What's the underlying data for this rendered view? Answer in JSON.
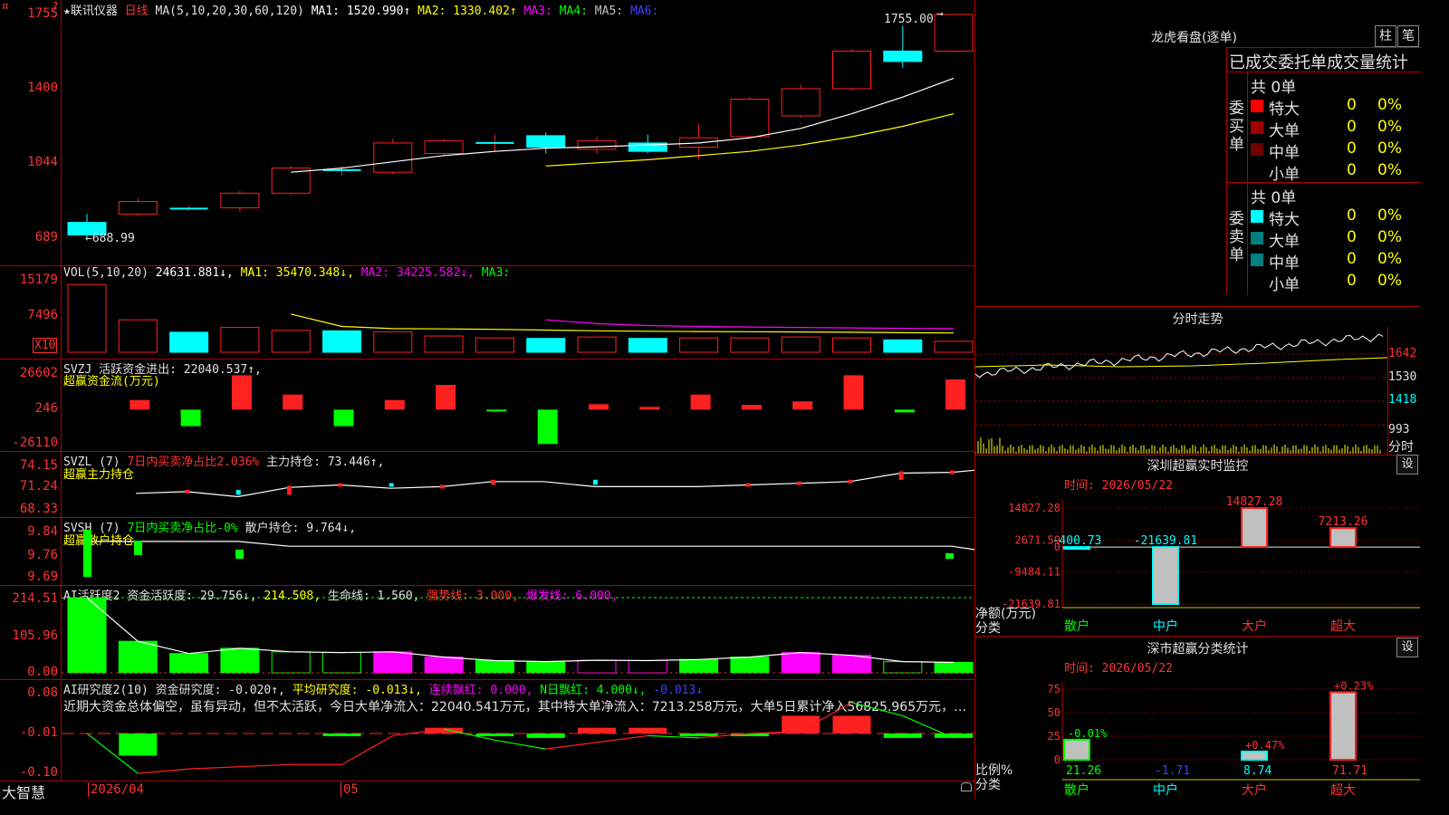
{
  "colors": {
    "up": "#ff2020",
    "down": "#00ffff",
    "green": "#00ff00",
    "magenta": "#ff00ff",
    "yellow": "#ffff00",
    "grid": "#b00000",
    "white": "#ffffff"
  },
  "corner": {
    "left_icon": "¤",
    "right_icon": "?"
  },
  "main": {
    "title_star": "★联讯仪器",
    "period": "日线",
    "ma_label": "MA(5,10,20,30,60,120)",
    "ma1": "MA1: 1520.990↑",
    "ma2": "MA2: 1330.402↑",
    "ma3": "MA3:",
    "ma4": "MA4:",
    "ma5": "MA5:",
    "ma6": "MA6:",
    "yticks": [
      "1755",
      "1400",
      "1044",
      "689"
    ],
    "high_label": "1755.00",
    "low_label": "←688.99"
  },
  "vol": {
    "label": "VOL(5,10,20)",
    "value": "24631.881↓,",
    "ma1": "MA1: 35470.348↓,",
    "ma2": "MA2: 34225.582↓,",
    "ma3": "MA3:",
    "yticks": [
      "15179",
      "7496"
    ],
    "unit": "X10"
  },
  "svzj": {
    "line1_a": "SVZJ  活跃资金进出: 22040.537↑,",
    "line2": "超赢资金流(万元)",
    "yticks": [
      "26602",
      "246",
      "-26110"
    ]
  },
  "svzl": {
    "line1_a": "SVZL (7) ",
    "line1_b": "7日内买卖净占比2.036%",
    "line1_c": " 主力持仓: 73.446↑,",
    "line2": "超赢主力持仓",
    "yticks": [
      "74.15",
      "71.24",
      "68.33"
    ]
  },
  "svsh": {
    "line1_a": "SVSH (7) ",
    "line1_b": "7日内买卖净占比-0%",
    "line1_c": " 散户持仓: 9.764↓,",
    "line2": "超赢散户持仓",
    "yticks": [
      "9.84",
      "9.76",
      "9.69"
    ]
  },
  "ai_act": {
    "a": "AI活跃度2 资金活跃度: 29.756↓,",
    "b": " 214.508,",
    "c": " 生命线: 1.560,",
    "d": " 强势线: 3.000,",
    "e": " 爆发线: 6.000,",
    "yticks": [
      "214.51",
      "105.96",
      "0.00"
    ]
  },
  "ai_res": {
    "a": "AI研究度2(10) 资金研究度: -0.020↑,",
    "b": " 平均研究度: -0.013↓,",
    "c": " 连续飘红: 0.000,",
    "d": " N日飘红: 4.000↓,",
    "e": " -0.013↓",
    "comment": "近期大资金总体偏空，虽有异动，但不太活跃，今日大单净流入：22040.541万元，其中特大单净流入：7213.258万元，大单5日累计净入56825.965万元，…",
    "yticks": [
      "0.08",
      "-0.01",
      "-0.10"
    ]
  },
  "chart_data": [
    {
      "type": "candlestick",
      "title": "★联讯仪器 日线",
      "ylim": [
        689,
        1755
      ],
      "candles": [
        {
          "o": 760,
          "c": 700,
          "h": 800,
          "l": 688.99,
          "up": false
        },
        {
          "o": 800,
          "c": 860,
          "h": 875,
          "l": 790,
          "up": true
        },
        {
          "o": 826,
          "c": 826,
          "h": 840,
          "l": 815,
          "up": "doji"
        },
        {
          "o": 830,
          "c": 900,
          "h": 910,
          "l": 810,
          "up": true
        },
        {
          "o": 900,
          "c": 1020,
          "h": 1030,
          "l": 890,
          "up": true
        },
        {
          "o": 1010,
          "c": 1010,
          "h": 1030,
          "l": 985,
          "up": "doji"
        },
        {
          "o": 1000,
          "c": 1140,
          "h": 1160,
          "l": 990,
          "up": true
        },
        {
          "o": 1090,
          "c": 1150,
          "h": 1160,
          "l": 1080,
          "up": true
        },
        {
          "o": 1140,
          "c": 1140,
          "h": 1180,
          "l": 1100,
          "up": "doji"
        },
        {
          "o": 1175,
          "c": 1120,
          "h": 1190,
          "l": 1090,
          "up": false
        },
        {
          "o": 1110,
          "c": 1150,
          "h": 1170,
          "l": 1090,
          "up": true
        },
        {
          "o": 1140,
          "c": 1100,
          "h": 1180,
          "l": 1090,
          "up": false
        },
        {
          "o": 1120,
          "c": 1165,
          "h": 1230,
          "l": 1060,
          "up": true
        },
        {
          "o": 1170,
          "c": 1350,
          "h": 1360,
          "l": 1160,
          "up": true
        },
        {
          "o": 1270,
          "c": 1400,
          "h": 1420,
          "l": 1260,
          "up": true
        },
        {
          "o": 1400,
          "c": 1580,
          "h": 1590,
          "l": 1390,
          "up": true
        },
        {
          "o": 1580,
          "c": 1530,
          "h": 1700,
          "l": 1500,
          "up": false
        },
        {
          "o": 1580,
          "c": 1755,
          "h": 1755,
          "l": 1575,
          "up": true
        }
      ],
      "ma1": [
        null,
        null,
        null,
        null,
        1000,
        1020,
        1050,
        1080,
        1100,
        1115,
        1122,
        1130,
        1140,
        1165,
        1210,
        1280,
        1360,
        1450
      ],
      "ma2": [
        null,
        null,
        null,
        null,
        null,
        null,
        null,
        null,
        null,
        1030,
        1045,
        1060,
        1080,
        1100,
        1130,
        1170,
        1220,
        1280
      ]
    },
    {
      "type": "bar",
      "title": "VOL(5,10,20)",
      "ylim": [
        0,
        15179
      ],
      "values": [
        14200,
        6800,
        4200,
        5200,
        4600,
        4500,
        4300,
        3400,
        3000,
        2900,
        3200,
        2900,
        3000,
        3000,
        3200,
        3000,
        2600,
        2300
      ],
      "up": [
        true,
        true,
        false,
        true,
        true,
        false,
        true,
        true,
        true,
        false,
        true,
        false,
        true,
        true,
        true,
        true,
        false,
        true
      ],
      "ma1": [
        null,
        null,
        null,
        null,
        8000,
        5400,
        4950,
        4900,
        4800,
        4650,
        4500,
        4400,
        4350,
        4300,
        4250,
        4200,
        4100,
        4050
      ],
      "ma2": [
        null,
        null,
        null,
        null,
        null,
        null,
        null,
        null,
        null,
        6800,
        6000,
        5600,
        5400,
        5300,
        5200,
        5100,
        5000,
        4950
      ]
    },
    {
      "type": "bar",
      "title": "SVZJ 活跃资金进出",
      "ylim": [
        -26110,
        26602
      ],
      "values": [
        0,
        7000,
        -12000,
        25000,
        11000,
        -12000,
        7000,
        18000,
        -500,
        -25000,
        4000,
        2000,
        11000,
        3500,
        6000,
        25000,
        -2000,
        22000
      ]
    },
    {
      "type": "line",
      "title": "SVZL 主力持仓",
      "ylim": [
        68.33,
        74.15
      ],
      "values": [
        null,
        70.4,
        70.6,
        70.0,
        71.1,
        71.4,
        71.0,
        71.2,
        71.8,
        71.8,
        71.2,
        71.2,
        71.2,
        71.4,
        71.6,
        71.8,
        72.8,
        72.9,
        73.446
      ]
    },
    {
      "type": "line",
      "title": "SVSH 散户持仓",
      "ylim": [
        9.69,
        9.84
      ],
      "values": [
        9.8,
        9.8,
        9.8,
        9.8,
        9.786,
        9.786,
        9.786,
        9.786,
        9.786,
        9.786,
        9.786,
        9.786,
        9.786,
        9.786,
        9.786,
        9.786,
        9.786,
        9.786,
        9.764
      ]
    },
    {
      "type": "bar",
      "title": "AI活跃度2",
      "ylim": [
        0,
        214.51
      ],
      "values": [
        214.51,
        90,
        55,
        70,
        60,
        58,
        60,
        45,
        35,
        32,
        36,
        35,
        38,
        45,
        58,
        50,
        32,
        29.756
      ],
      "colors": [
        "green",
        "green",
        "green",
        "green",
        "green",
        "green",
        "magenta",
        "magenta",
        "green",
        "green",
        "magenta",
        "magenta",
        "green",
        "green",
        "magenta",
        "magenta",
        "green",
        "green"
      ]
    },
    {
      "type": "bar",
      "title": "AI研究度2(10)",
      "ylim": [
        -0.1,
        0.08
      ],
      "values": [
        0,
        -0.06,
        0,
        0,
        0,
        -0.002,
        0,
        0.003,
        -0.01,
        -0.02,
        0.003,
        0.003,
        -0.003,
        -0.01,
        0.03,
        0.03,
        -0.02,
        -0.02
      ],
      "line": [
        -0.01,
        -0.1,
        -0.09,
        -0.085,
        -0.08,
        -0.08,
        -0.015,
        0.0,
        -0.025,
        -0.045,
        -0.03,
        -0.015,
        -0.02,
        -0.01,
        -0.005,
        0.06,
        0.03,
        -0.02
      ]
    },
    {
      "type": "line",
      "title": "分时走势",
      "yticks": [
        "1642",
        "1530",
        "1418",
        "993"
      ]
    },
    {
      "type": "bar",
      "title": "深圳超赢实时监控",
      "categories": [
        "散户",
        "中户",
        "大户",
        "超大"
      ],
      "values": [
        -400.73,
        -21639.81,
        14827.28,
        7213.26
      ],
      "ylim": [
        -21639.81,
        14827.28
      ],
      "yticks": [
        "14827.28",
        "2671.59",
        "0",
        "-9484.11",
        "-21639.81"
      ]
    },
    {
      "type": "bar",
      "title": "深市超赢分类统计",
      "categories": [
        "散户",
        "中户",
        "大户",
        "超大"
      ],
      "values": [
        21.26,
        -1.71,
        8.74,
        71.71
      ],
      "changes": [
        "-0.01%",
        "",
        "+0.47%",
        "+0.23%"
      ],
      "ylim": [
        0,
        75
      ],
      "yticks": [
        "75",
        "50",
        "25",
        "0"
      ]
    }
  ],
  "xaxis": {
    "left_label": "大智慧",
    "date1": "2026/04",
    "date2": "05",
    "lock_icon": "lock-icon"
  },
  "right": {
    "lhb_title": "龙虎看盘(逐单)",
    "btn_bar": "柱",
    "btn_pen": "笔",
    "table_title": "已成交委托单成交量统计",
    "buy_side": "委买单",
    "sell_side": "委卖单",
    "buy_total": "共 0单",
    "sell_total": "共 0单",
    "rows_buy": [
      {
        "label": "特大",
        "count": "0",
        "pct": "0%",
        "color": "#ff0000"
      },
      {
        "label": "大单",
        "count": "0",
        "pct": "0%",
        "color": "#a00000"
      },
      {
        "label": "中单",
        "count": "0",
        "pct": "0%",
        "color": "#700000"
      },
      {
        "label": "小单",
        "count": "0",
        "pct": "0%",
        "color": ""
      }
    ],
    "rows_sell": [
      {
        "label": "特大",
        "count": "0",
        "pct": "0%",
        "color": "#00ffff"
      },
      {
        "label": "大单",
        "count": "0",
        "pct": "0%",
        "color": "#008080"
      },
      {
        "label": "中单",
        "count": "0",
        "pct": "0%",
        "color": "#008080"
      },
      {
        "label": "小单",
        "count": "0",
        "pct": "0%",
        "color": ""
      }
    ],
    "fenshi_title": "分时走势",
    "fenshi_yticks": [
      "1642",
      "1530",
      "1418",
      "993"
    ],
    "fenshi_bottom": "分时",
    "sz_title": "深圳超赢实时监控",
    "sz_set": "设",
    "sz_time": "时间: 2026/05/22",
    "sz_unit1": "净额(万元)",
    "sz_unit2": "分类",
    "cls_title": "深市超赢分类统计",
    "cls_set": "设",
    "cls_time": "时间: 2026/05/22",
    "cls_unit1": "比例%",
    "cls_unit2": "分类"
  }
}
